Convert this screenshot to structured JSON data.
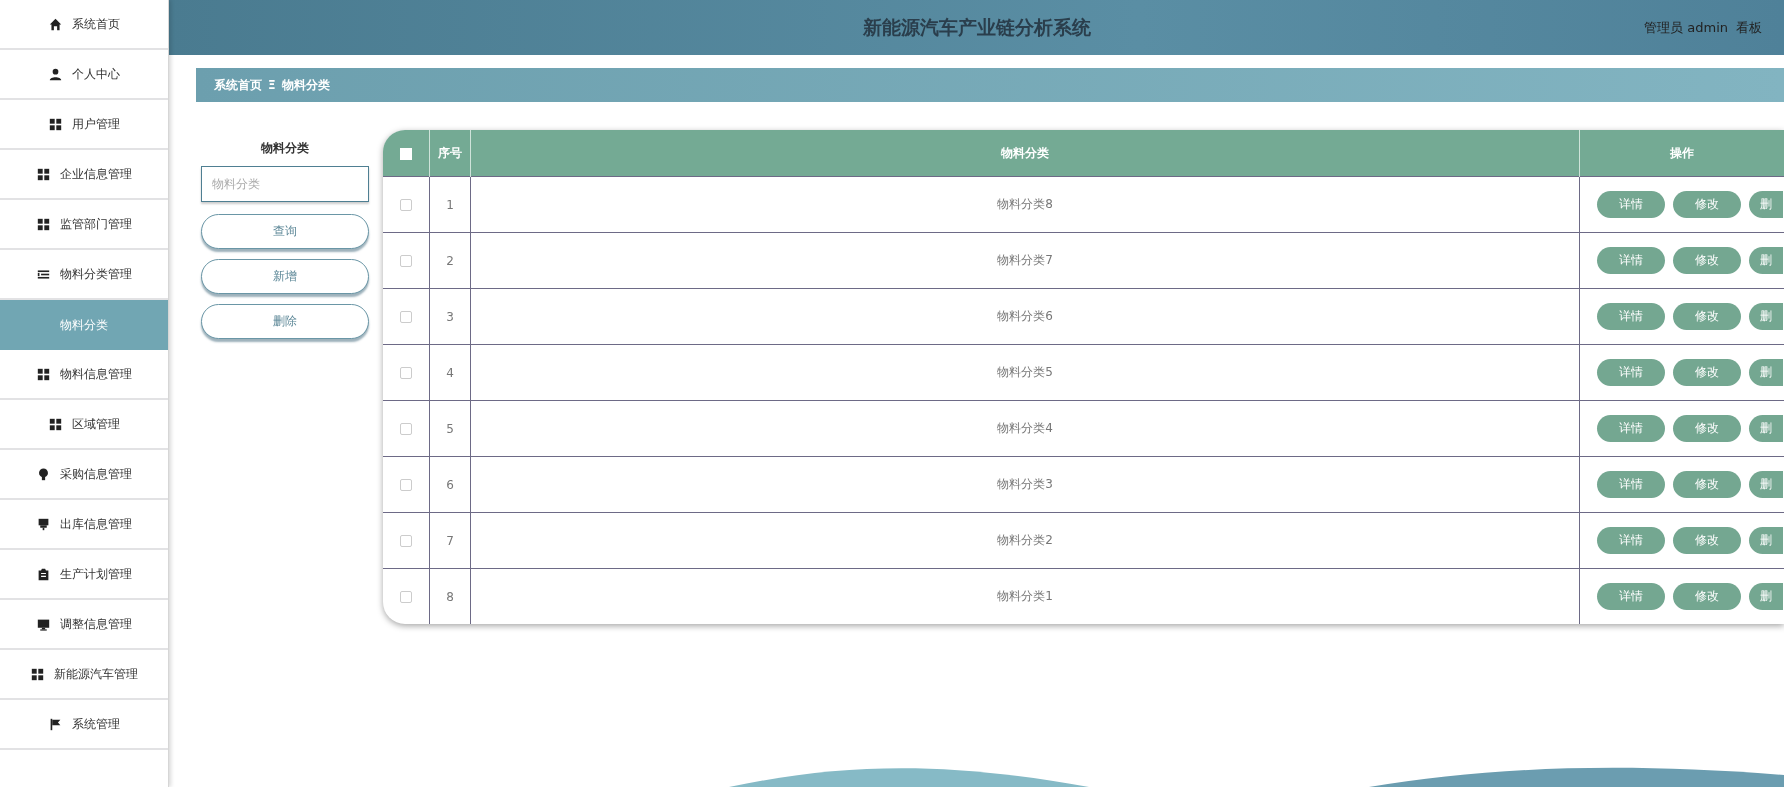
{
  "sidebar": {
    "items": [
      {
        "label": "系统首页",
        "selected": false
      },
      {
        "label": "个人中心",
        "selected": false
      },
      {
        "label": "用户管理",
        "selected": false
      },
      {
        "label": "企业信息管理",
        "selected": false
      },
      {
        "label": "监管部门管理",
        "selected": false
      },
      {
        "label": "物料分类管理",
        "selected": false,
        "children": [
          {
            "label": "物料分类",
            "selected": true
          }
        ]
      },
      {
        "label": "物料信息管理",
        "selected": false
      },
      {
        "label": "区域管理",
        "selected": false
      },
      {
        "label": "采购信息管理",
        "selected": false
      },
      {
        "label": "出库信息管理",
        "selected": false
      },
      {
        "label": "生产计划管理",
        "selected": false
      },
      {
        "label": "调整信息管理",
        "selected": false
      },
      {
        "label": "新能源汽车管理",
        "selected": false
      },
      {
        "label": "系统管理",
        "selected": false
      }
    ]
  },
  "header": {
    "title": "新能源汽车产业链分析系统",
    "user": "管理员 admin",
    "link": "看板"
  },
  "breadcrumb": {
    "home": "系统首页",
    "separator": "Ξ",
    "current": "物料分类"
  },
  "search": {
    "label": "物料分类",
    "placeholder": "物料分类",
    "buttons": [
      "查询",
      "新增",
      "删除"
    ]
  },
  "table": {
    "select_all_checked": false,
    "columns": [
      "序号",
      "物料分类",
      "操作"
    ],
    "rows": [
      {
        "index": "1",
        "name": "物料分类8",
        "checked": false,
        "actions": [
          "详情",
          "修改",
          "删"
        ]
      },
      {
        "index": "2",
        "name": "物料分类7",
        "checked": false,
        "actions": [
          "详情",
          "修改",
          "删"
        ]
      },
      {
        "index": "3",
        "name": "物料分类6",
        "checked": false,
        "actions": [
          "详情",
          "修改",
          "删"
        ]
      },
      {
        "index": "4",
        "name": "物料分类5",
        "checked": false,
        "actions": [
          "详情",
          "修改",
          "删"
        ]
      },
      {
        "index": "5",
        "name": "物料分类4",
        "checked": false,
        "actions": [
          "详情",
          "修改",
          "删"
        ]
      },
      {
        "index": "6",
        "name": "物料分类3",
        "checked": false,
        "actions": [
          "详情",
          "修改",
          "删"
        ]
      },
      {
        "index": "7",
        "name": "物料分类2",
        "checked": false,
        "actions": [
          "详情",
          "修改",
          "删"
        ]
      },
      {
        "index": "8",
        "name": "物料分类1",
        "checked": false,
        "actions": [
          "详情",
          "修改",
          "删"
        ]
      }
    ]
  }
}
